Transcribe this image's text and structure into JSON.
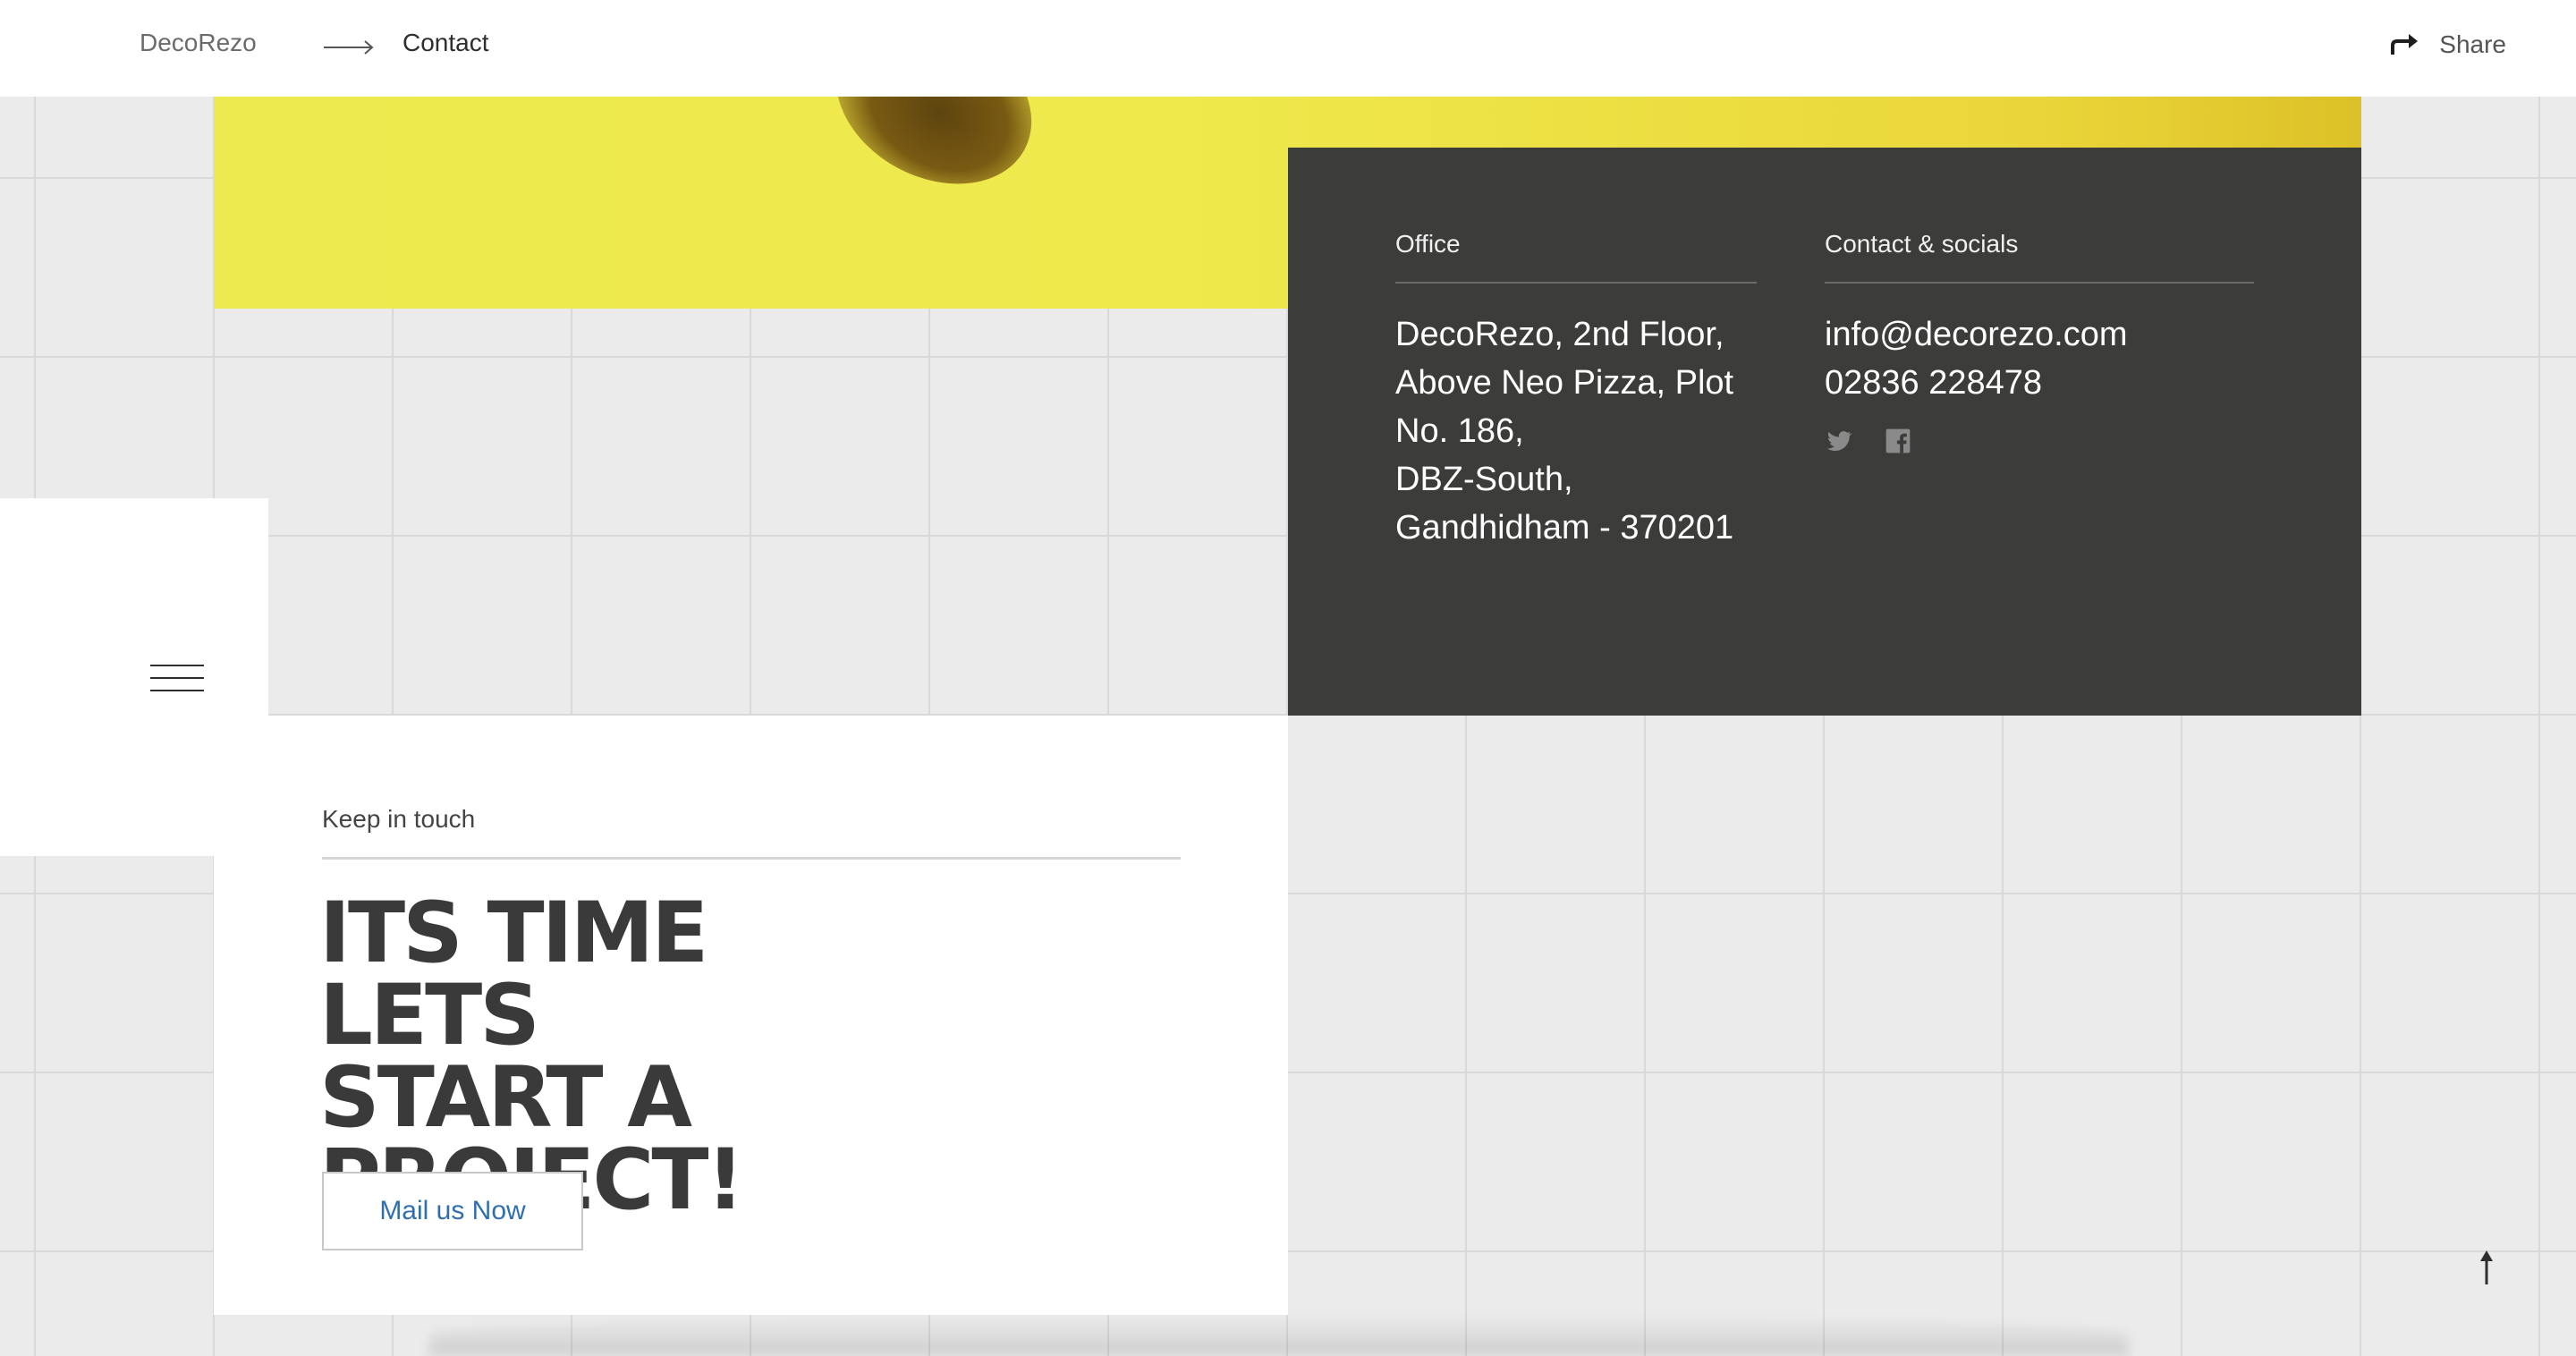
{
  "breadcrumb": {
    "home": "DecoRezo",
    "current": "Contact"
  },
  "header": {
    "share_label": "Share"
  },
  "office": {
    "heading": "Office",
    "address_lines": [
      "DecoRezo, 2nd Floor,",
      "Above Neo Pizza, Plot",
      "No. 186,",
      "DBZ-South,",
      "Gandhidham - 370201"
    ]
  },
  "contact": {
    "heading": "Contact & socials",
    "email": "info@decorezo.com",
    "phone": "02836 228478",
    "socials": [
      "twitter-icon",
      "facebook-icon"
    ]
  },
  "cta": {
    "eyebrow": "Keep in touch",
    "heading_lines": [
      "ITS TIME LETS",
      "START A",
      "PROJECT!"
    ],
    "button_label": "Mail us Now"
  },
  "colors": {
    "panel_bg": "#3c3c3b",
    "hero_yellow": "#ecea4e",
    "link_blue": "#2f6fad",
    "heading_text": "#3a3a3a"
  }
}
